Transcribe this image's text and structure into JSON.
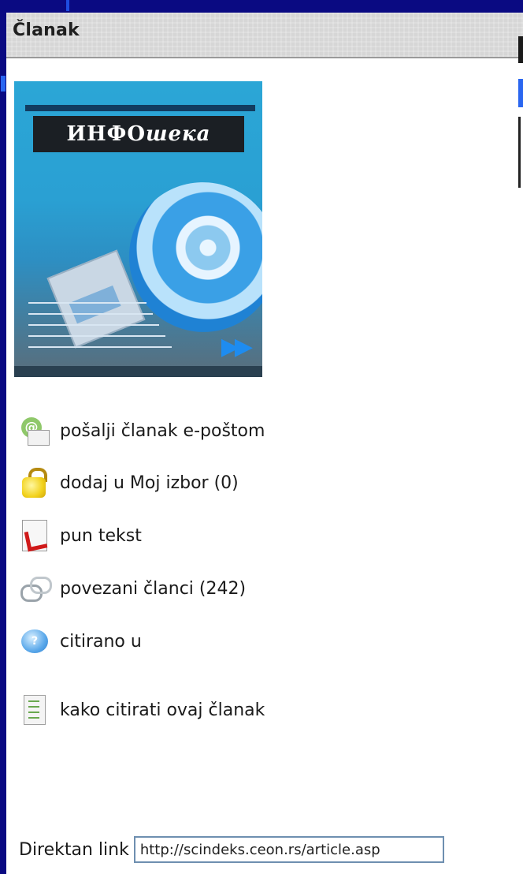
{
  "panel": {
    "title": "Članak"
  },
  "cover": {
    "title_prefix": "ИНФО",
    "title_suffix": "шека"
  },
  "actions": [
    {
      "icon": "email-icon",
      "label": "pošalji članak e-poštom"
    },
    {
      "icon": "lock-icon",
      "label": "dodaj u Moj izbor (0)"
    },
    {
      "icon": "pdf-icon",
      "label": "pun tekst"
    },
    {
      "icon": "link-icon",
      "label": "povezani članci (242)"
    },
    {
      "icon": "cite-icon",
      "label": "citirano u"
    },
    {
      "icon": "list-icon",
      "label": "kako citirati ovaj članak"
    }
  ],
  "direct_link": {
    "label": "Direktan link",
    "value": "http://scindeks.ceon.rs/article.asp"
  }
}
